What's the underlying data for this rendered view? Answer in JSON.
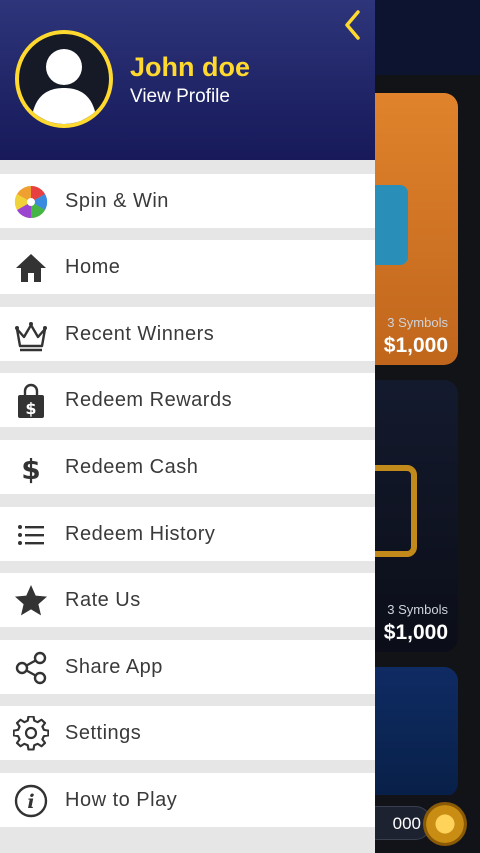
{
  "colors": {
    "accent": "#ffd92e",
    "header_bg": "#1f2466",
    "menu_bg": "#ffffff",
    "page_bg": "#e6e6e6",
    "icon": "#333333"
  },
  "profile": {
    "name": "John doe",
    "subtitle": "View Profile",
    "back_icon": "chevron-left-icon",
    "avatar_icon": "user-silhouette-icon"
  },
  "menu": [
    {
      "label": "Spin & Win",
      "icon": "spin-wheel-icon"
    },
    {
      "label": "Home",
      "icon": "home-icon"
    },
    {
      "label": "Recent Winners",
      "icon": "crown-icon"
    },
    {
      "label": "Redeem Rewards",
      "icon": "shopping-bag-icon"
    },
    {
      "label": "Redeem Cash",
      "icon": "dollar-icon"
    },
    {
      "label": "Redeem History",
      "icon": "list-icon"
    },
    {
      "label": "Rate Us",
      "icon": "star-icon"
    },
    {
      "label": "Share App",
      "icon": "share-icon"
    },
    {
      "label": "Settings",
      "icon": "gear-icon"
    },
    {
      "label": "How to Play",
      "icon": "info-icon"
    }
  ],
  "background": {
    "cards": [
      {
        "line": "3 Symbols",
        "price": "$1,000"
      },
      {
        "line": "3 Symbols",
        "price": "$1,000"
      }
    ],
    "bottom_value": "000"
  }
}
